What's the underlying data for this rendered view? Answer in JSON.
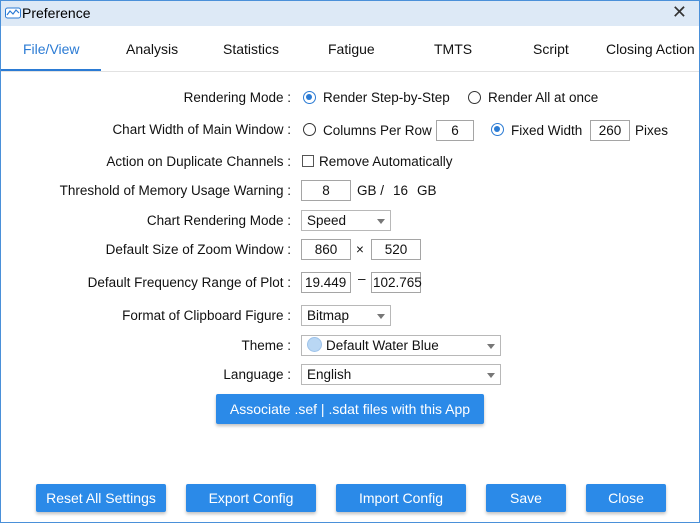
{
  "window": {
    "title": "Preference",
    "close_glyph": "✕"
  },
  "tabs": [
    {
      "label": "File/View",
      "active": true
    },
    {
      "label": "Analysis"
    },
    {
      "label": "Statistics"
    },
    {
      "label": "Fatigue"
    },
    {
      "label": "TMTS"
    },
    {
      "label": "Script"
    },
    {
      "label": "Closing Action"
    }
  ],
  "settings": {
    "rendering_mode": {
      "label": "Rendering Mode :",
      "options": [
        {
          "label": "Render Step-by-Step",
          "selected": true
        },
        {
          "label": "Render All at once",
          "selected": false
        }
      ]
    },
    "chart_width": {
      "label": "Chart Width of Main Window :",
      "columns_label": "Columns Per Row",
      "columns_value": "6",
      "columns_selected": false,
      "fixed_label": "Fixed Width",
      "fixed_value": "260",
      "fixed_selected": true,
      "unit": "Pixes"
    },
    "duplicate_channels": {
      "label": "Action on Duplicate Channels :",
      "option_label": "Remove Automatically",
      "checked": false
    },
    "memory_warning": {
      "label": "Threshold of Memory Usage Warning :",
      "value": "8",
      "unit": "GB /",
      "total": "16",
      "total_unit": "GB"
    },
    "chart_rendering_mode": {
      "label": "Chart Rendering Mode :",
      "value": "Speed"
    },
    "zoom_window": {
      "label": "Default Size of Zoom Window :",
      "width": "860",
      "separator": "×",
      "height": "520"
    },
    "frequency_range": {
      "label": "Default Frequency Range of Plot :",
      "min": "19.449",
      "separator": "–",
      "max": "102.765"
    },
    "clipboard_format": {
      "label": "Format of Clipboard Figure :",
      "value": "Bitmap"
    },
    "theme": {
      "label": "Theme :",
      "value": "Default Water Blue",
      "swatch_color": "#b9d7f4"
    },
    "language": {
      "label": "Language :",
      "value": "English"
    },
    "associate_button": "Associate .sef | .sdat files with this App"
  },
  "footer": {
    "reset": "Reset All Settings",
    "export": "Export Config",
    "import": "Import Config",
    "save": "Save",
    "close": "Close"
  },
  "colors": {
    "accent": "#2b8ae8",
    "titlebar": "#dde9f6",
    "active_tab": "#2b7bd4"
  }
}
